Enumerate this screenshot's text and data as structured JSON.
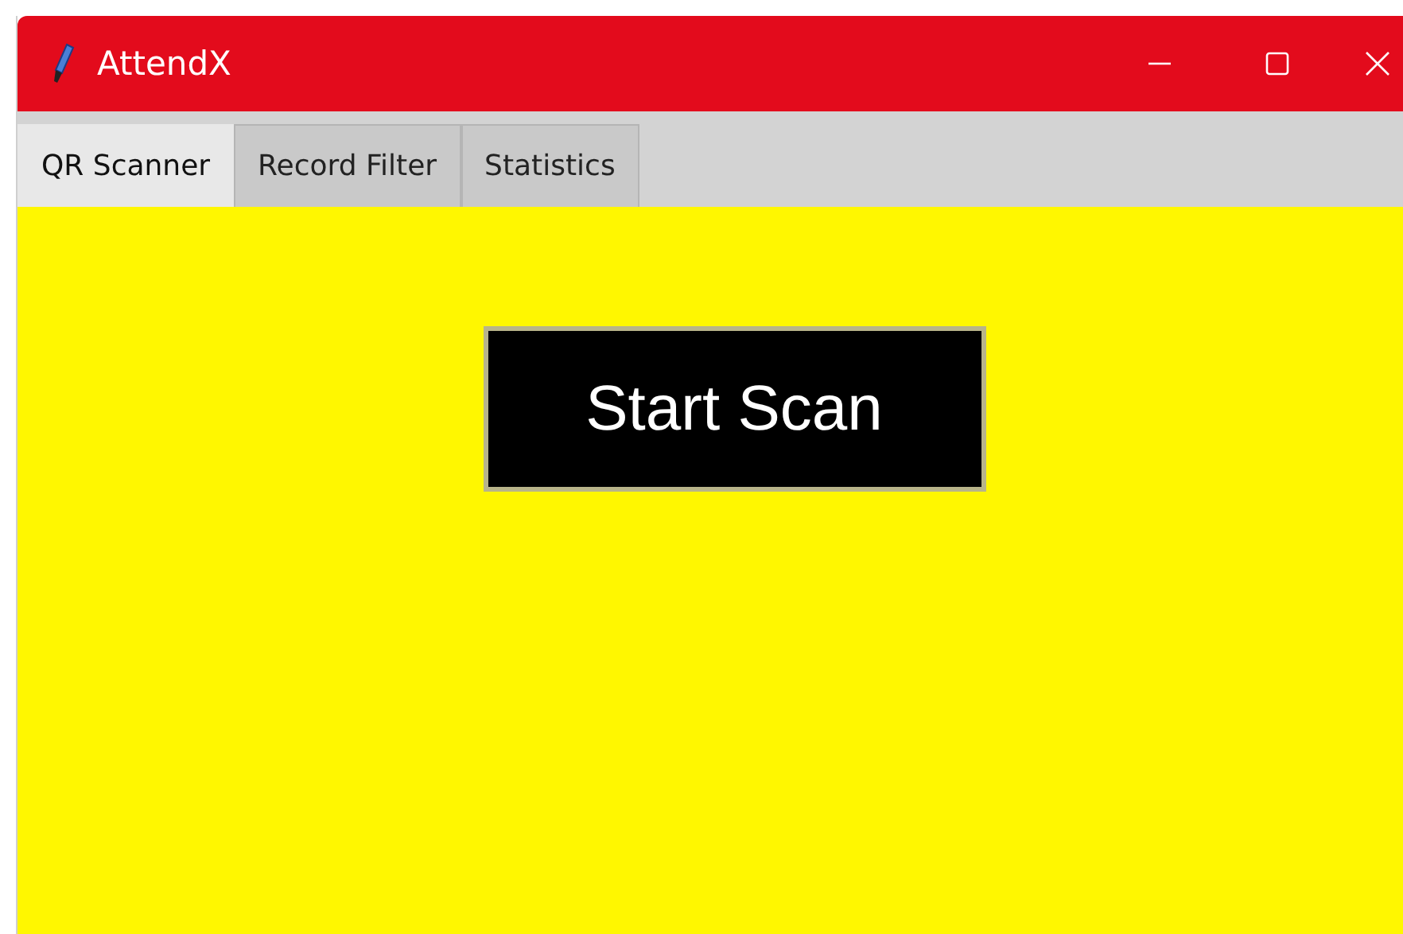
{
  "window": {
    "title": "AttendX"
  },
  "tabs": [
    {
      "label": "QR Scanner",
      "selected": true
    },
    {
      "label": "Record Filter",
      "selected": false
    },
    {
      "label": "Statistics",
      "selected": false
    }
  ],
  "buttons": [
    "Start Scan"
  ]
}
